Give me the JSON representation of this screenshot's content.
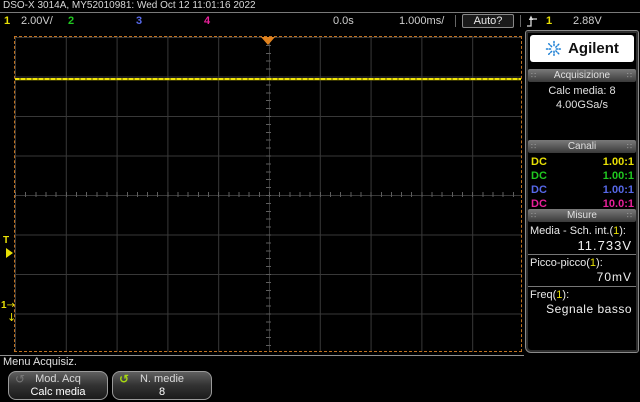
{
  "titlebar": {
    "model_serial_datetime": "DSO-X 3014A, MY52010981: Wed Oct 12 11:01:16 2022"
  },
  "statusbar": {
    "channels": [
      {
        "num": "1",
        "scale": "2.00V/"
      },
      {
        "num": "2",
        "scale": ""
      },
      {
        "num": "3",
        "scale": ""
      },
      {
        "num": "4",
        "scale": ""
      }
    ],
    "delay": "0.0s",
    "timebase": "1.000ms/",
    "trigger_mode": "Auto?",
    "trigger_source": "1",
    "trigger_level": "2.88V"
  },
  "scope": {
    "trigger_level_marker": "T",
    "ground_marker_channel": "1"
  },
  "sidebar": {
    "brand": "Agilent",
    "acquisition": {
      "title": "Acquisizione",
      "line1": "Calc media: 8",
      "line2": "4.00GSa/s"
    },
    "channels": {
      "title": "Canali",
      "rows": [
        {
          "coupling": "DC",
          "ratio": "1.00:1"
        },
        {
          "coupling": "DC",
          "ratio": "1.00:1"
        },
        {
          "coupling": "DC",
          "ratio": "1.00:1"
        },
        {
          "coupling": "DC",
          "ratio": "10.0:1"
        }
      ]
    },
    "measures": {
      "title": "Misure",
      "items": [
        {
          "pre": "Media - Sch. int.(",
          "ch": "1",
          "post": "):",
          "value": "11.733V"
        },
        {
          "pre": "Picco-picco(",
          "ch": "1",
          "post": "):",
          "value": "70mV"
        },
        {
          "pre": "Freq(",
          "ch": "1",
          "post": "):",
          "value": "Segnale basso"
        }
      ]
    }
  },
  "menu": {
    "label": "Menu Acquisiz.",
    "softkeys": [
      {
        "line1": "Mod. Acq",
        "line2": "Calc media"
      },
      {
        "line1": "N. medie",
        "line2": "8"
      }
    ]
  },
  "colors": {
    "ch1": "#e8e005",
    "ch2": "#20c820",
    "ch3": "#5668e8",
    "ch4": "#e8209a",
    "trigger_orange": "#e0821e",
    "graticule_border": "#c27422",
    "trace": "#f0e40a"
  }
}
